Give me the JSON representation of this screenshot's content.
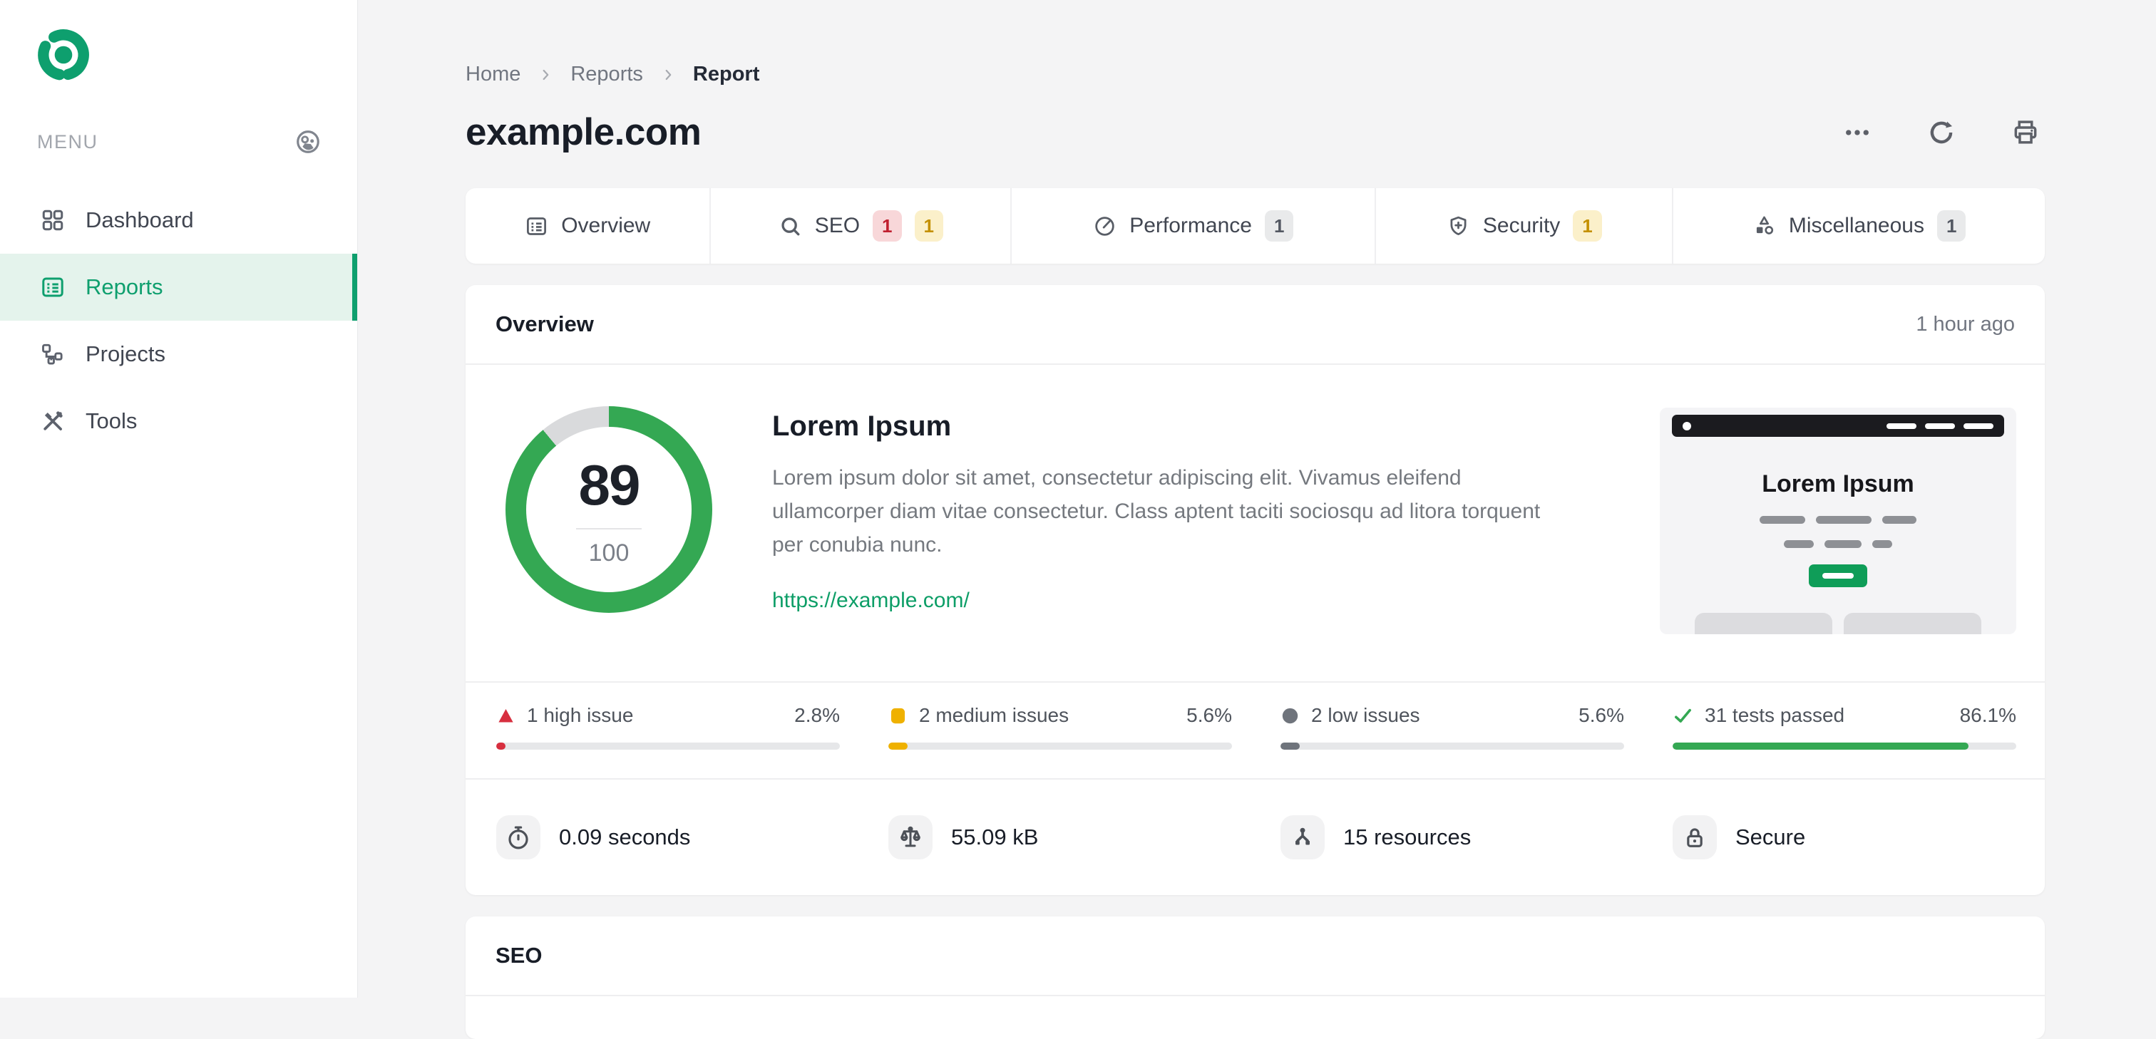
{
  "theme": {
    "accent_green": "#0e9f6e",
    "score_green": "#34a853",
    "ring_track": "#d9dadc",
    "link_green": "#0d9e67",
    "thumb_button_green": "#0f9d58",
    "high_red": "#d72f3f",
    "medium_yellow": "#efb100",
    "low_gray": "#6f747c",
    "passed_green": "#34a853",
    "badge_red_bg": "#f8d7d9",
    "badge_yellow_bg": "#fbf0ca",
    "badge_gray_bg": "#e9eaeb"
  },
  "sidebar": {
    "menu_label": "MENU",
    "items": [
      {
        "label": "Dashboard",
        "icon": "grid-icon",
        "active": false
      },
      {
        "label": "Reports",
        "icon": "list-icon",
        "active": true
      },
      {
        "label": "Projects",
        "icon": "hierarchy-icon",
        "active": false
      },
      {
        "label": "Tools",
        "icon": "tools-icon",
        "active": false
      }
    ]
  },
  "breadcrumb": {
    "items": [
      "Home",
      "Reports",
      "Report"
    ]
  },
  "header": {
    "title": "example.com",
    "actions": [
      {
        "icon": "more-icon"
      },
      {
        "icon": "refresh-icon"
      },
      {
        "icon": "print-icon"
      }
    ]
  },
  "tabs": [
    {
      "label": "Overview",
      "icon": "list-icon",
      "badges": []
    },
    {
      "label": "SEO",
      "icon": "search-icon",
      "badges": [
        {
          "text": "1",
          "type": "red"
        },
        {
          "text": "1",
          "type": "yellow"
        }
      ]
    },
    {
      "label": "Performance",
      "icon": "gauge-icon",
      "badges": [
        {
          "text": "1",
          "type": "gray"
        }
      ]
    },
    {
      "label": "Security",
      "icon": "shield-icon",
      "badges": [
        {
          "text": "1",
          "type": "yellow"
        }
      ]
    },
    {
      "label": "Miscellaneous",
      "icon": "shapes-icon",
      "badges": [
        {
          "text": "1",
          "type": "gray"
        }
      ]
    }
  ],
  "overview": {
    "section_title": "Overview",
    "timestamp": "1 hour ago",
    "score": {
      "value": "89",
      "total": "100",
      "percent": 89,
      "color": "#34a853",
      "track": "#d9dadc"
    },
    "site": {
      "heading": "Lorem Ipsum",
      "description": "Lorem ipsum dolor sit amet, consectetur adipiscing elit. Vivamus eleifend ullamcorper diam vitae consectetur. Class aptent taciti sociosqu ad litora torquent per conubia nunc.",
      "link": "https://example.com/"
    },
    "thumbnail": {
      "heading": "Lorem Ipsum"
    },
    "issues": [
      {
        "label": "1 high issue",
        "percent_label": "2.8%",
        "percent": 2.8,
        "type": "high",
        "color": "#d72f3f",
        "icon": "triangle-icon"
      },
      {
        "label": "2 medium issues",
        "percent_label": "5.6%",
        "percent": 5.6,
        "type": "medium",
        "color": "#efb100",
        "icon": "square-icon"
      },
      {
        "label": "2 low issues",
        "percent_label": "5.6%",
        "percent": 5.6,
        "type": "low",
        "color": "#6f747c",
        "icon": "circle-icon"
      },
      {
        "label": "31 tests passed",
        "percent_label": "86.1%",
        "percent": 86.1,
        "type": "passed",
        "color": "#34a853",
        "icon": "check-icon"
      }
    ],
    "quick_stats": [
      {
        "value": "0.09 seconds",
        "icon": "stopwatch-icon"
      },
      {
        "value": "55.09 kB",
        "icon": "scale-icon"
      },
      {
        "value": "15 resources",
        "icon": "sitemap-icon"
      },
      {
        "value": "Secure",
        "icon": "lock-icon"
      }
    ]
  },
  "seo_section": {
    "title": "SEO"
  }
}
